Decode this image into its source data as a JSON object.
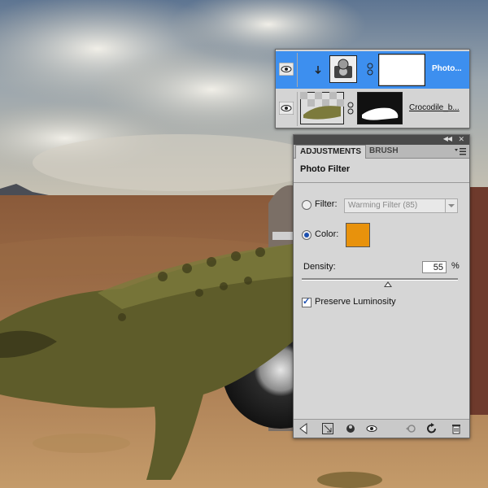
{
  "layers_panel": {
    "layers": [
      {
        "name": "Photo...",
        "selected": true,
        "thumb_icon": "photo-filter-adjustment-icon",
        "mask_icon": "white-mask-thumbnail"
      },
      {
        "name": "Crocodile_b...",
        "selected": false,
        "thumb_icon": "crocodile-layer-thumbnail",
        "mask_icon": "crocodile-mask-thumbnail"
      }
    ],
    "selected_color": "#3d8fef"
  },
  "adjustments": {
    "tabs": [
      "ADJUSTMENTS",
      "BRUSH"
    ],
    "active_tab": "ADJUSTMENTS",
    "title": "Photo Filter",
    "filter_label": "Filter:",
    "filter_value": "Warming Filter (85)",
    "filter_selected": false,
    "color_label": "Color:",
    "color_selected": true,
    "color_value": "#e8920c",
    "density_label": "Density:",
    "density_value": "55",
    "density_unit": "%",
    "density_fraction": 0.55,
    "preserve_label": "Preserve Luminosity",
    "preserve_checked": true,
    "footer_icons": [
      "back-arrow-icon",
      "expand-view-icon",
      "clip-to-layer-icon",
      "visibility-eye-icon",
      "previous-state-icon",
      "reset-icon",
      "trash-icon"
    ]
  }
}
